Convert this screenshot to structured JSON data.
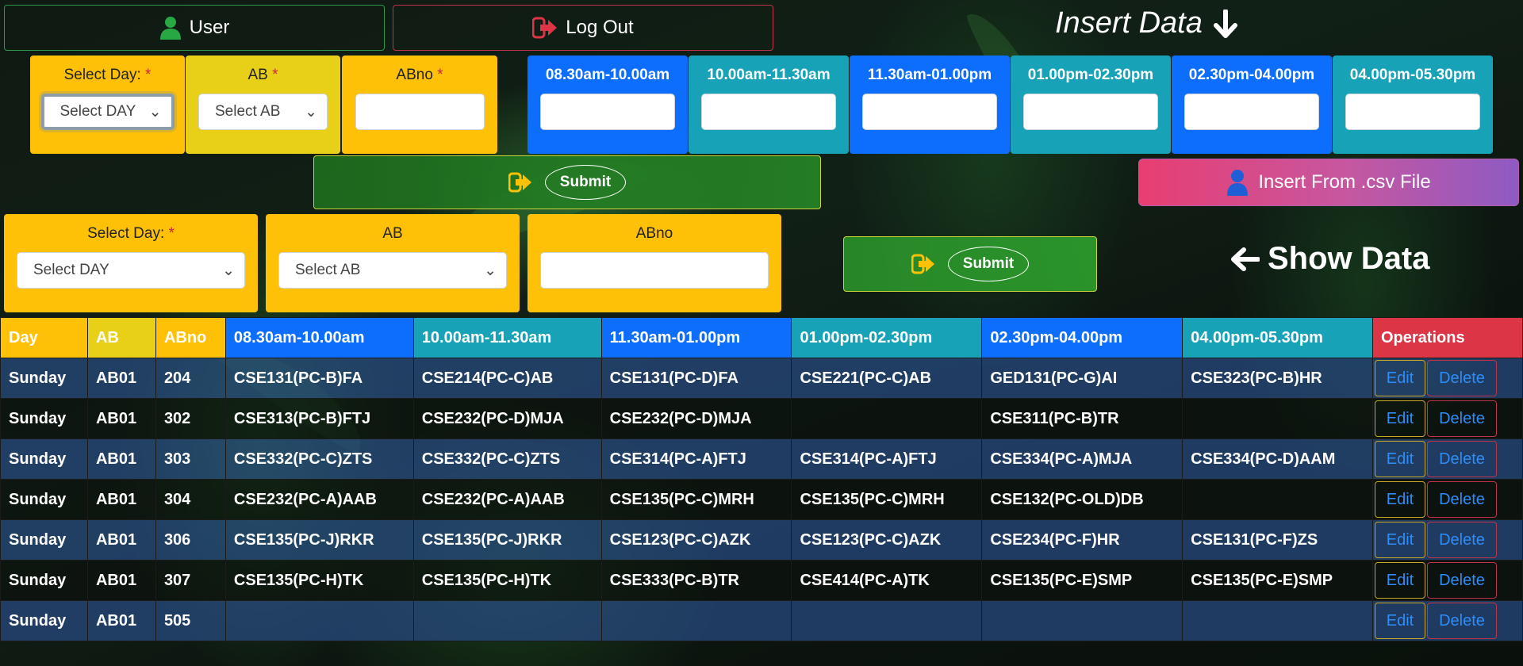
{
  "top_bar": {
    "user_label": "User",
    "logout_label": "Log Out",
    "insert_heading": "Insert Data"
  },
  "insert_form": {
    "day_label": "Select Day:",
    "day_placeholder": "Select DAY",
    "ab_label": "AB",
    "ab_placeholder": "Select AB",
    "abno_label": "ABno",
    "required_mark": "*",
    "slots": [
      "08.30am-10.00am",
      "10.00am-11.30am",
      "11.30am-01.00pm",
      "01.00pm-02.30pm",
      "02.30pm-04.00pm",
      "04.00pm-05.30pm"
    ],
    "submit_label": "Submit",
    "csv_label": "Insert From .csv File"
  },
  "show_form": {
    "day_label": "Select Day:",
    "day_placeholder": "Select DAY",
    "ab_label": "AB",
    "ab_placeholder": "Select AB",
    "abno_label": "ABno",
    "required_mark": "*",
    "submit_label": "Submit",
    "show_heading": "Show Data"
  },
  "table": {
    "headers": [
      "Day",
      "AB",
      "ABno",
      "08.30am-10.00am",
      "10.00am-11.30am",
      "11.30am-01.00pm",
      "01.00pm-02.30pm",
      "02.30pm-04.00pm",
      "04.00pm-05.30pm",
      "Operations"
    ],
    "edit_label": "Edit",
    "delete_label": "Delete",
    "rows": [
      [
        "Sunday",
        "AB01",
        "204",
        "CSE131(PC-B)FA",
        "CSE214(PC-C)AB",
        "CSE131(PC-D)FA",
        "CSE221(PC-C)AB",
        "GED131(PC-G)AI",
        "CSE323(PC-B)HR"
      ],
      [
        "Sunday",
        "AB01",
        "302",
        "CSE313(PC-B)FTJ",
        "CSE232(PC-D)MJA",
        "CSE232(PC-D)MJA",
        "",
        "CSE311(PC-B)TR",
        ""
      ],
      [
        "Sunday",
        "AB01",
        "303",
        "CSE332(PC-C)ZTS",
        "CSE332(PC-C)ZTS",
        "CSE314(PC-A)FTJ",
        "CSE314(PC-A)FTJ",
        "CSE334(PC-A)MJA",
        "CSE334(PC-D)AAM"
      ],
      [
        "Sunday",
        "AB01",
        "304",
        "CSE232(PC-A)AAB",
        "CSE232(PC-A)AAB",
        "CSE135(PC-C)MRH",
        "CSE135(PC-C)MRH",
        "CSE132(PC-OLD)DB",
        ""
      ],
      [
        "Sunday",
        "AB01",
        "306",
        "CSE135(PC-J)RKR",
        "CSE135(PC-J)RKR",
        "CSE123(PC-C)AZK",
        "CSE123(PC-C)AZK",
        "CSE234(PC-F)HR",
        "CSE131(PC-F)ZS"
      ],
      [
        "Sunday",
        "AB01",
        "307",
        "CSE135(PC-H)TK",
        "CSE135(PC-H)TK",
        "CSE333(PC-B)TR",
        "CSE414(PC-A)TK",
        "CSE135(PC-E)SMP",
        "CSE135(PC-E)SMP"
      ],
      [
        "Sunday",
        "AB01",
        "505",
        "",
        "",
        "",
        "",
        "",
        ""
      ]
    ],
    "header_colors": [
      "#ffc107",
      "#e8cf18",
      "#ffc107",
      "#0d6efd",
      "#17a2b8",
      "#0d6efd",
      "#17a2b8",
      "#0d6efd",
      "#17a2b8",
      "#dc3545"
    ]
  }
}
